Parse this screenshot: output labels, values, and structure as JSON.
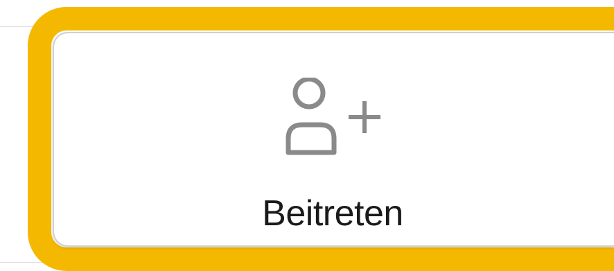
{
  "join_button": {
    "label": "Beitreten",
    "icon": "add-person-icon"
  },
  "colors": {
    "highlight": "#f5b800",
    "icon_stroke": "#8a8a8a",
    "label_text": "#1a1a1a"
  }
}
